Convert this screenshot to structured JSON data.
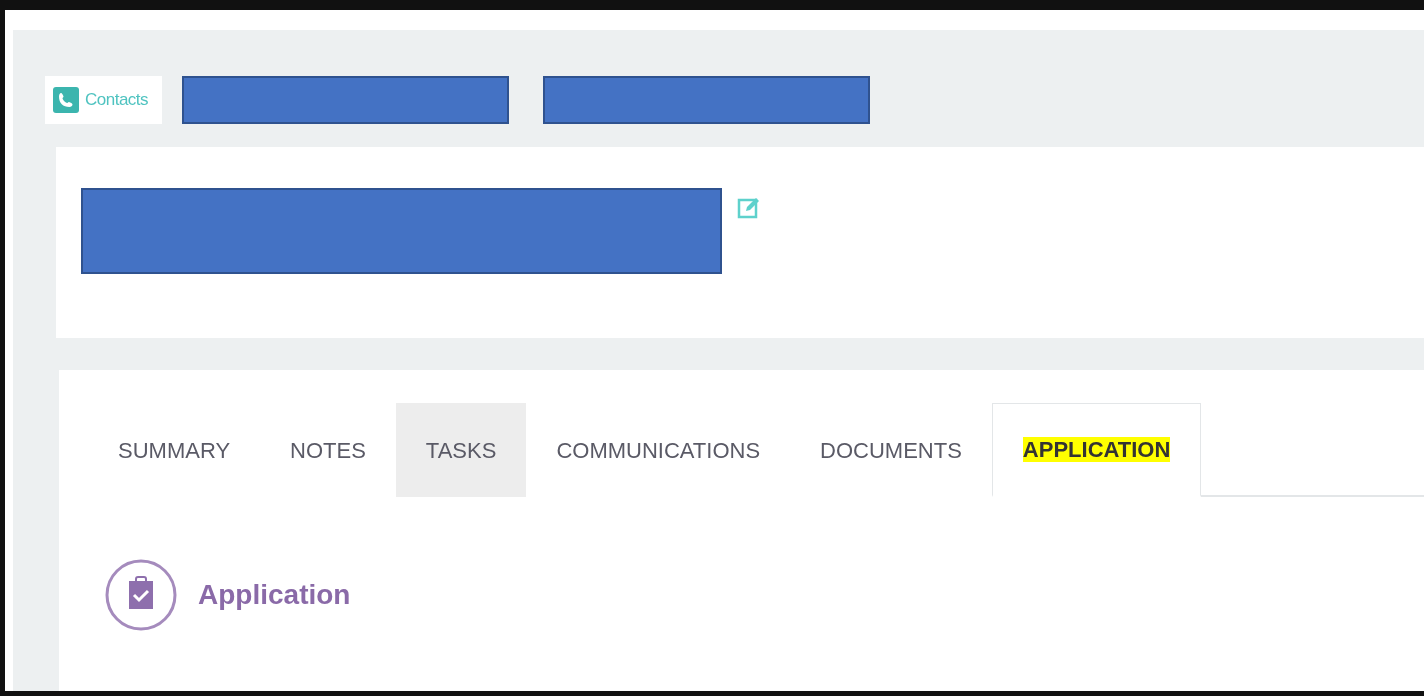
{
  "breadcrumb": {
    "items": [
      {
        "kind": "link",
        "label": "Contacts"
      },
      {
        "kind": "redacted"
      },
      {
        "kind": "redacted"
      }
    ]
  },
  "record": {
    "title_redacted": true
  },
  "tabs": [
    {
      "label": "SUMMARY",
      "selected": false,
      "hovered": false,
      "highlighted": false
    },
    {
      "label": "NOTES",
      "selected": false,
      "hovered": false,
      "highlighted": false
    },
    {
      "label": "TASKS",
      "selected": false,
      "hovered": true,
      "highlighted": false
    },
    {
      "label": "COMMUNICATIONS",
      "selected": false,
      "hovered": false,
      "highlighted": false
    },
    {
      "label": "DOCUMENTS",
      "selected": false,
      "hovered": false,
      "highlighted": false
    },
    {
      "label": "APPLICATION",
      "selected": true,
      "hovered": false,
      "highlighted": true
    }
  ],
  "section": {
    "title": "Application"
  }
}
